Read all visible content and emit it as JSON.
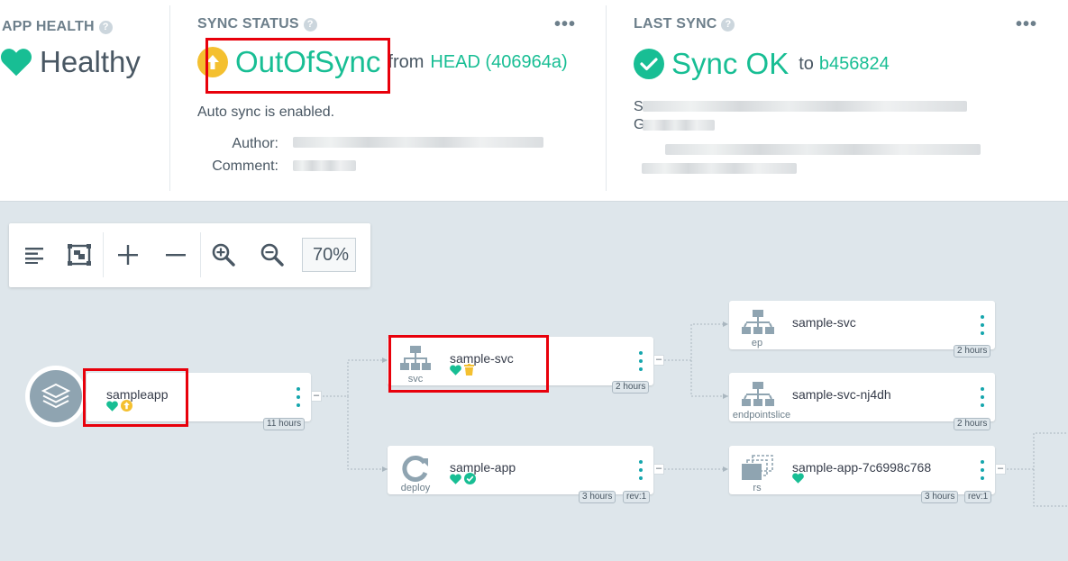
{
  "app_health": {
    "title": "APP HEALTH",
    "value": "Healthy"
  },
  "sync_status": {
    "title": "SYNC STATUS",
    "value": "OutOfSync",
    "from_label": "from",
    "revision": "HEAD (406964a)",
    "auto_sync": "Auto sync is enabled.",
    "author_label": "Author:",
    "comment_label": "Comment:"
  },
  "last_sync": {
    "title": "LAST SYNC",
    "value": "Sync OK",
    "to_label": "to",
    "revision": "b456824",
    "line_s": "S",
    "line_g": "G"
  },
  "toolbar": {
    "zoom": "70%"
  },
  "nodes": {
    "sampleapp": {
      "name": "sampleapp",
      "age": "11 hours"
    },
    "svc": {
      "name": "sample-svc",
      "kind": "svc",
      "age": "2 hours"
    },
    "deploy": {
      "name": "sample-app",
      "kind": "deploy",
      "age": "3 hours",
      "rev": "rev:1"
    },
    "ep": {
      "name": "sample-svc",
      "kind": "ep",
      "age": "2 hours"
    },
    "eps": {
      "name": "sample-svc-nj4dh",
      "kind": "endpointslice",
      "age": "2 hours"
    },
    "rs": {
      "name": "sample-app-7c6998c768",
      "kind": "rs",
      "age": "3 hours",
      "rev": "rev:1"
    }
  },
  "colors": {
    "healthy": "#18be94",
    "out_of_sync": "#f4c030",
    "highlight": "#e8000b",
    "link": "#18be94"
  },
  "icons": [
    "heart-icon",
    "arrow-up-circle-icon",
    "check-circle-icon",
    "trash-icon",
    "help-icon",
    "more-icon",
    "list-icon",
    "fit-icon",
    "plus-icon",
    "minus-icon",
    "zoom-in-icon",
    "zoom-out-icon",
    "layers-icon",
    "network-icon",
    "sync-icon",
    "replicaset-icon"
  ]
}
